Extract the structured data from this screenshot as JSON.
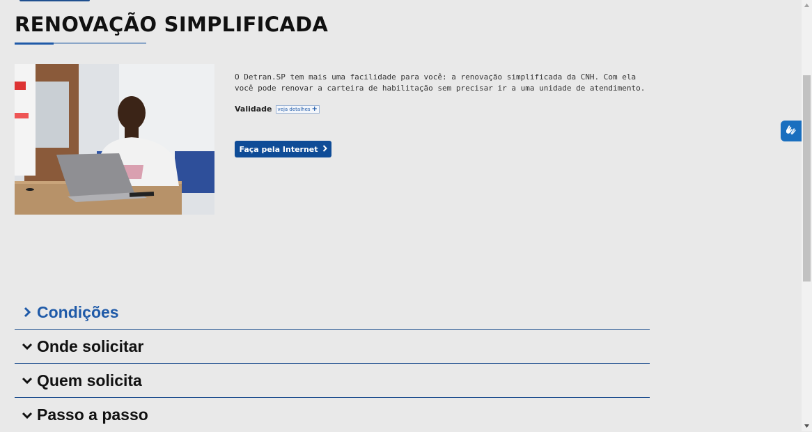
{
  "page": {
    "title": "RENOVAÇÃO SIMPLIFICADA"
  },
  "intro": {
    "text": "O Detran.SP tem mais uma facilidade para você: a renovação simplificada da CNH. Com ela você pode renovar a carteira de habilitação sem precisar ir a uma unidade de atendimento.",
    "validity_label": "Validade",
    "details_link": "veja detalhes"
  },
  "cta": {
    "label": "Faça pela Internet"
  },
  "accordion": {
    "items": [
      {
        "label": "Condições",
        "state": "collapsed",
        "icon": "chevron-right-icon"
      },
      {
        "label": "Onde solicitar",
        "state": "collapsed",
        "icon": "chevron-down-icon"
      },
      {
        "label": "Quem solicita",
        "state": "collapsed",
        "icon": "chevron-down-icon"
      },
      {
        "label": "Passo a passo",
        "state": "collapsed",
        "icon": "chevron-down-icon"
      }
    ]
  },
  "colors": {
    "accent": "#1f5aa8",
    "button": "#0f4c97",
    "background": "#e9e9e9"
  }
}
